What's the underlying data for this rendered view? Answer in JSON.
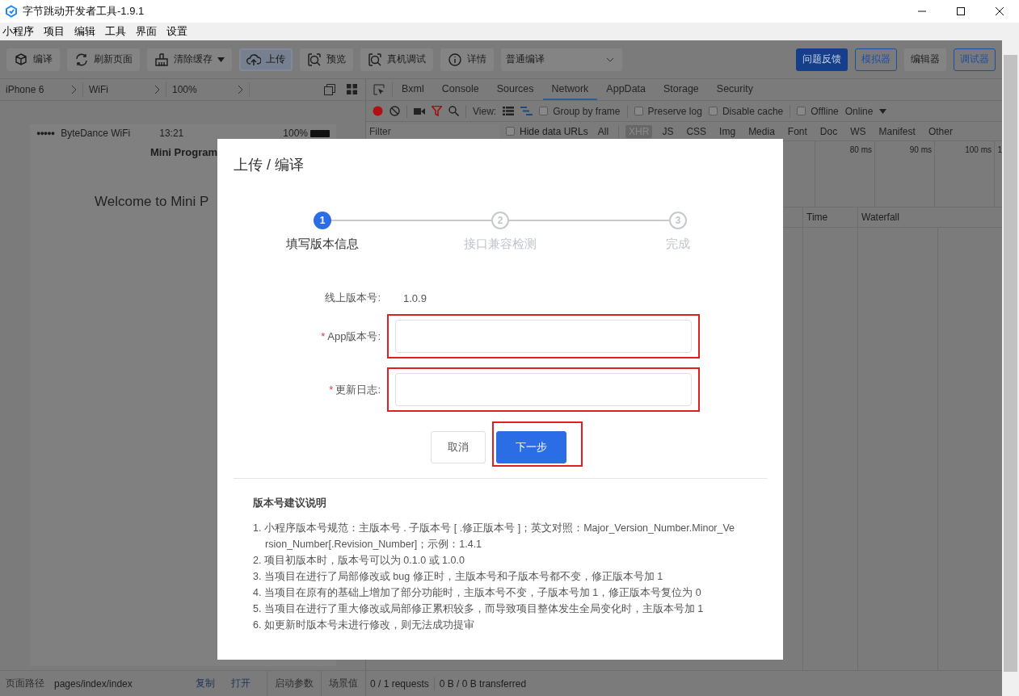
{
  "window": {
    "title": "字节跳动开发者工具-1.9.1"
  },
  "menu": [
    "小程序",
    "项目",
    "编辑",
    "工具",
    "界面",
    "设置"
  ],
  "toolbar": {
    "buttons": [
      {
        "label": "编译",
        "selected": false,
        "dropdown": false
      },
      {
        "label": "刷新页面",
        "selected": false,
        "dropdown": false
      },
      {
        "label": "清除缓存",
        "selected": false,
        "dropdown": true
      },
      {
        "label": "上传",
        "selected": true,
        "dropdown": false
      },
      {
        "label": "预览",
        "selected": false,
        "dropdown": false
      },
      {
        "label": "真机调试",
        "selected": false,
        "dropdown": false
      },
      {
        "label": "详情",
        "selected": false,
        "dropdown": false
      }
    ],
    "compile_mode": "普通编译",
    "panels": [
      {
        "label": "问题反馈",
        "kind": "primary"
      },
      {
        "label": "模拟器",
        "kind": "outline"
      },
      {
        "label": "编辑器",
        "kind": "plain"
      },
      {
        "label": "调试器",
        "kind": "outline"
      }
    ]
  },
  "device_bar": [
    "iPhone 6",
    "WiFi",
    "100%"
  ],
  "simulator": {
    "signal": "●●●●●",
    "carrier": "ByteDance WiFi",
    "time": "13:21",
    "battery": "100%",
    "page_title": "Mini Program",
    "content": "Welcome to Mini P"
  },
  "devtools": {
    "tabs": [
      {
        "label": "Bxml",
        "selected": false
      },
      {
        "label": "Console",
        "selected": false
      },
      {
        "label": "Sources",
        "selected": false
      },
      {
        "label": "Network",
        "selected": true
      },
      {
        "label": "AppData",
        "selected": false
      },
      {
        "label": "Storage",
        "selected": false
      },
      {
        "label": "Security",
        "selected": false
      }
    ],
    "view_label": "View:",
    "options": [
      {
        "label": "Group by frame",
        "checked": false
      },
      {
        "label": "Preserve log",
        "checked": false
      },
      {
        "label": "Disable cache",
        "checked": false
      },
      {
        "label": "Offline",
        "checked": false
      }
    ],
    "throttle": "Online",
    "filter_placeholder": "Filter",
    "hide_data_urls": {
      "label": "Hide data URLs",
      "checked": false
    },
    "types": [
      {
        "label": "All",
        "selected": false
      },
      {
        "label": "XHR",
        "selected": true
      },
      {
        "label": "JS",
        "selected": false
      },
      {
        "label": "CSS",
        "selected": false
      },
      {
        "label": "Img",
        "selected": false
      },
      {
        "label": "Media",
        "selected": false
      },
      {
        "label": "Font",
        "selected": false
      },
      {
        "label": "Doc",
        "selected": false
      },
      {
        "label": "WS",
        "selected": false
      },
      {
        "label": "Manifest",
        "selected": false
      },
      {
        "label": "Other",
        "selected": false
      }
    ],
    "timeline_ticks": [
      "80 ms",
      "90 ms",
      "100 ms",
      "1"
    ],
    "columns": [
      "Time",
      "Waterfall"
    ]
  },
  "status_bar": {
    "path_label": "页面路径",
    "path": "pages/index/index",
    "links": [
      "复制",
      "打开"
    ],
    "buttons": [
      "启动参数",
      "场景值"
    ],
    "requests": "0 / 1 requests",
    "transferred": "0 B / 0 B transferred"
  },
  "dialog": {
    "title": "上传 / 编译",
    "steps": [
      {
        "number": "1",
        "label": "填写版本信息",
        "active": true
      },
      {
        "number": "2",
        "label": "接口兼容检测",
        "active": false
      },
      {
        "number": "3",
        "label": "完成",
        "active": false
      }
    ],
    "online_version": {
      "label": "线上版本号:",
      "value": "1.0.9"
    },
    "fields": [
      {
        "required_mark": "*",
        "label": "App版本号:",
        "highlighted": true
      },
      {
        "required_mark": "*",
        "label": "更新日志:",
        "highlighted": true
      }
    ],
    "buttons": [
      {
        "label": "取消",
        "kind": "default",
        "highlighted": false
      },
      {
        "label": "下一步",
        "kind": "primary",
        "highlighted": true
      }
    ],
    "notes": {
      "title": "版本号建议说明",
      "items": [
        "1. 小程序版本号规范：主版本号 . 子版本号 [ .修正版本号 ]；英文对照：Major_Version_Number.Minor_Version_Number[.Revision_Number]；示例：1.4.1",
        "2. 项目初版本时，版本号可以为 0.1.0 或 1.0.0",
        "3. 当项目在进行了局部修改或 bug 修正时，主版本号和子版本号都不变，修正版本号加 1",
        "4. 当项目在原有的基础上增加了部分功能时，主版本号不变，子版本号加 1，修正版本号复位为 0",
        "5. 当项目在进行了重大修改或局部修正累积较多，而导致项目整体发生全局变化时，主版本号加 1",
        "6. 如更新时版本号未进行修改，则无法成功提审"
      ]
    }
  }
}
